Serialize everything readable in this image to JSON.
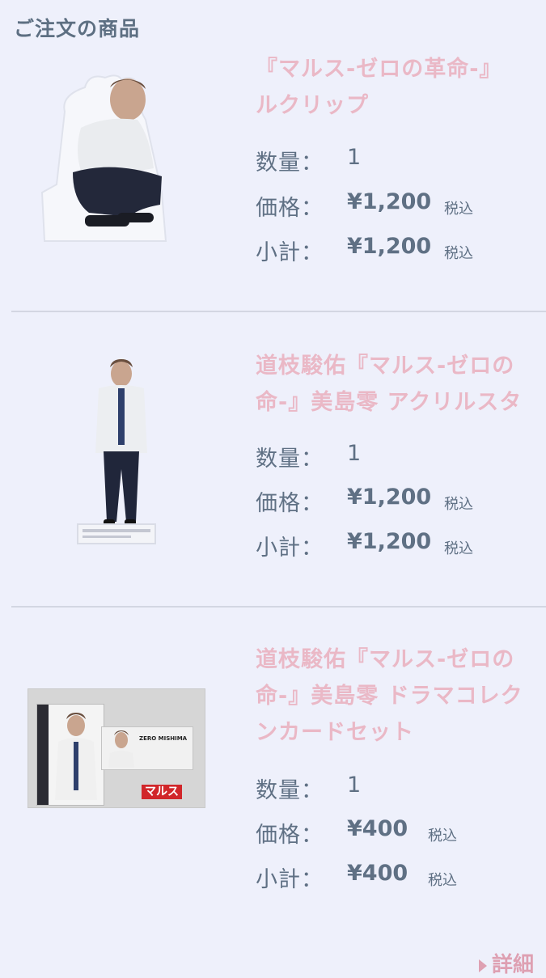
{
  "header": {
    "title": "ご注文の商品"
  },
  "items": [
    {
      "name_lines": [
        "『マルス-ゼロの革命-』",
        "ルクリップ"
      ],
      "quantity_label": "数量：",
      "quantity": "1",
      "price_label": "価格：",
      "price": "¥1,200",
      "price_tax": "税込",
      "subtotal_label": "小計：",
      "subtotal": "¥1,200",
      "subtotal_tax": "税込",
      "image_icon": "acrylic-clip-figure"
    },
    {
      "name_lines": [
        "道枝駿佑『マルス-ゼロの",
        "命-』美島零 アクリルスタ"
      ],
      "quantity_label": "数量：",
      "quantity": "1",
      "price_label": "価格：",
      "price": "¥1,200",
      "price_tax": "税込",
      "subtotal_label": "小計：",
      "subtotal": "¥1,200",
      "subtotal_tax": "税込",
      "image_icon": "acrylic-stand-figure"
    },
    {
      "name_lines": [
        "道枝駿佑『マルス-ゼロの",
        "命-』美島零 ドラマコレク",
        "ンカードセット"
      ],
      "quantity_label": "数量：",
      "quantity": "1",
      "price_label": "価格：",
      "price": "¥400",
      "price_tax": "税込",
      "subtotal_label": "小計：",
      "subtotal": "¥400",
      "subtotal_tax": "税込",
      "image_icon": "card-set",
      "card_text": {
        "name": "ZERO MISHIMA",
        "logo": "マルス"
      }
    }
  ],
  "footer": {
    "details_label": "詳細"
  }
}
